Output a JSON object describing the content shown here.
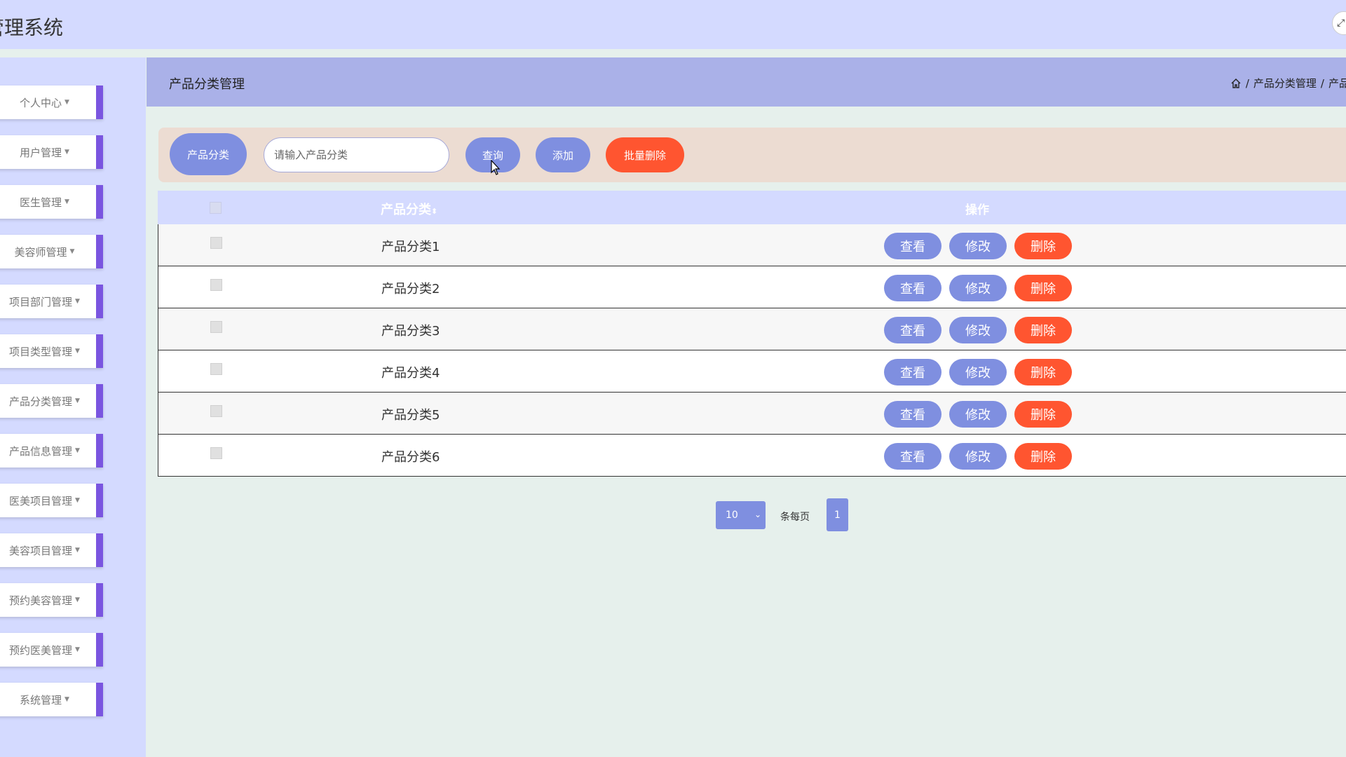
{
  "header": {
    "app_title": "管理系统"
  },
  "sidebar": {
    "items": [
      {
        "label": "个人中心"
      },
      {
        "label": "用户管理"
      },
      {
        "label": "医生管理"
      },
      {
        "label": "美容师管理"
      },
      {
        "label": "项目部门管理"
      },
      {
        "label": "项目类型管理"
      },
      {
        "label": "产品分类管理"
      },
      {
        "label": "产品信息管理"
      },
      {
        "label": "医美项目管理"
      },
      {
        "label": "美容项目管理"
      },
      {
        "label": "预约美容管理"
      },
      {
        "label": "预约医美管理"
      },
      {
        "label": "系统管理"
      }
    ]
  },
  "page": {
    "title": "产品分类管理",
    "breadcrumb": [
      "产品分类管理",
      "产品分"
    ]
  },
  "search": {
    "label": "产品分类",
    "placeholder": "请输入产品分类",
    "query_label": "查询",
    "add_label": "添加",
    "batch_delete_label": "批量删除"
  },
  "table": {
    "columns": {
      "name": "产品分类",
      "ops": "操作"
    },
    "sort_icon": "sort-icon",
    "rows": [
      {
        "name": "产品分类1"
      },
      {
        "name": "产品分类2"
      },
      {
        "name": "产品分类3"
      },
      {
        "name": "产品分类4"
      },
      {
        "name": "产品分类5"
      },
      {
        "name": "产品分类6"
      }
    ],
    "view_label": "查看",
    "edit_label": "修改",
    "delete_label": "删除"
  },
  "pagination": {
    "page_size": "10",
    "per_page_label": "条每页",
    "current_page": "1"
  },
  "colors": {
    "accent": "#7f8fe0",
    "danger": "#ff5530",
    "sidebar_bg": "#d4daff",
    "menu_border": "#7a55e0"
  }
}
